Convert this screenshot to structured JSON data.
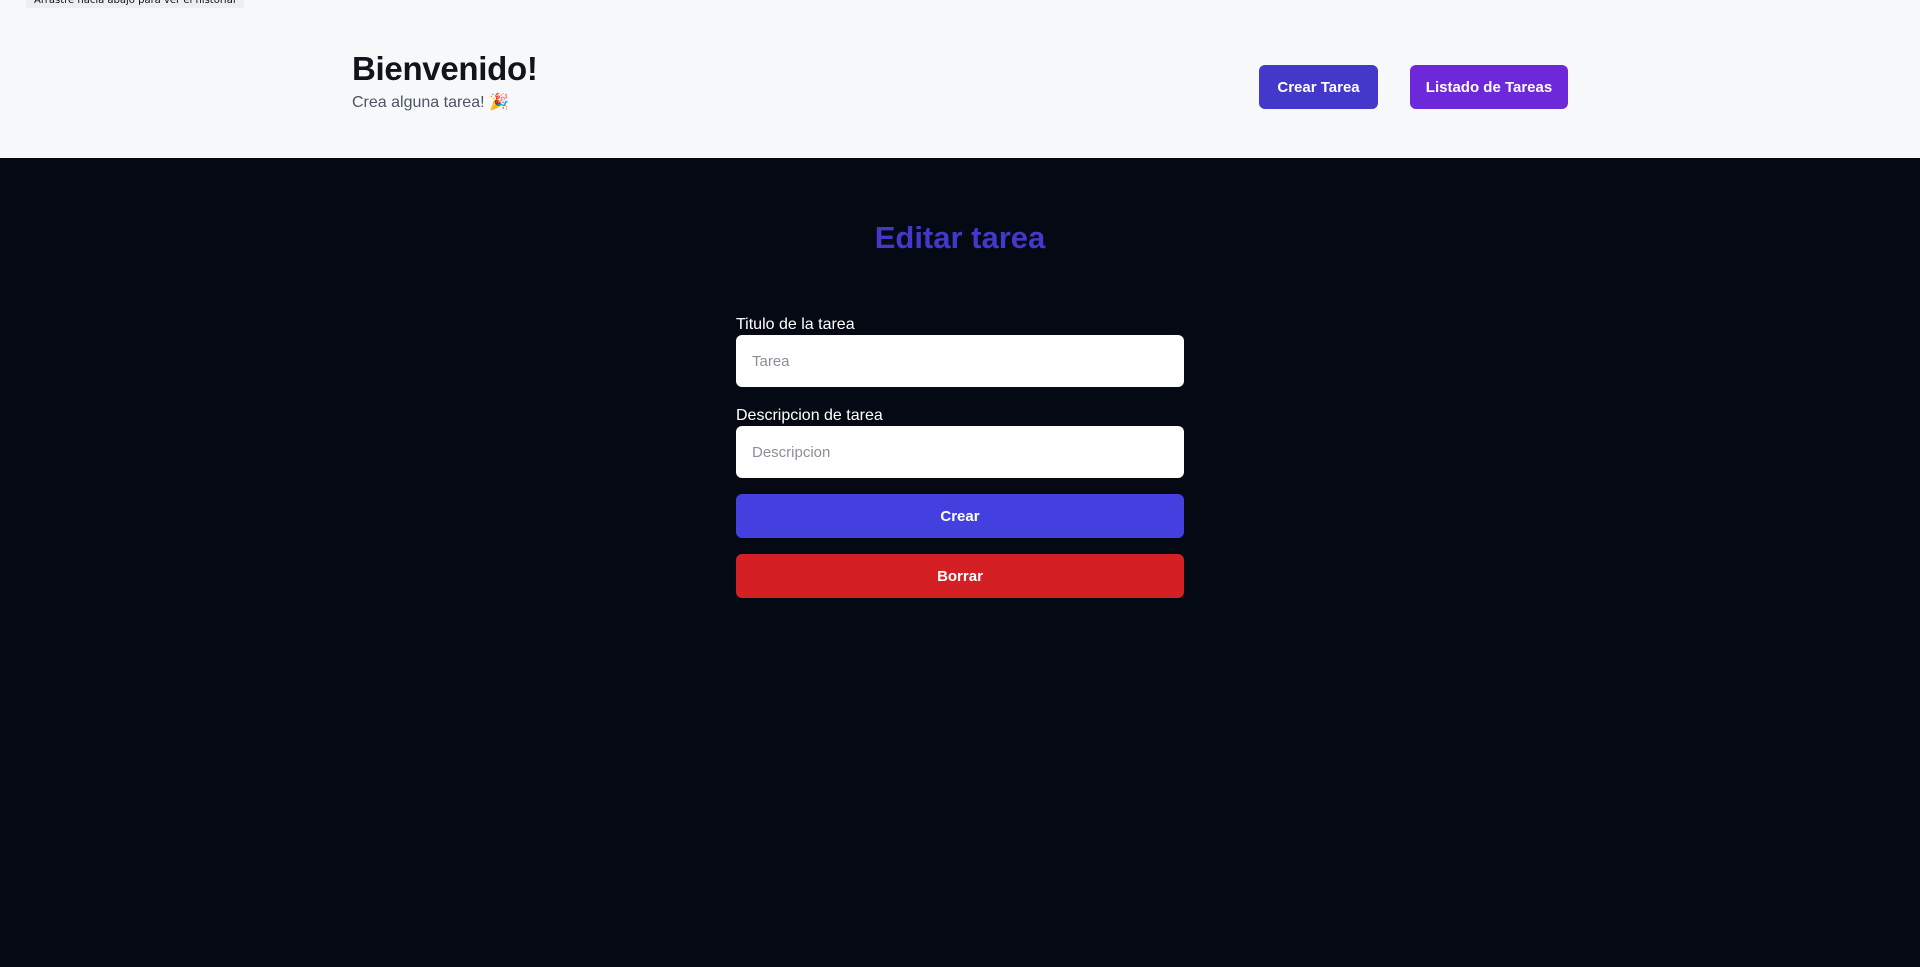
{
  "tooltip": "Arrastre hacia abajo para ver el historial",
  "header": {
    "title": "Bienvenido!",
    "subtitle": "Crea alguna tarea! 🎉",
    "nav": {
      "create_label": "Crear Tarea",
      "list_label": "Listado de Tareas"
    }
  },
  "main": {
    "title": "Editar tarea",
    "form": {
      "title_label": "Titulo de la tarea",
      "title_placeholder": "Tarea",
      "title_value": "",
      "description_label": "Descripcion de tarea",
      "description_placeholder": "Descripcion",
      "description_value": "",
      "submit_label": "Crear",
      "delete_label": "Borrar"
    }
  },
  "colors": {
    "header_bg": "#f7f8fa",
    "page_bg": "#050913",
    "accent_indigo": "#4338ca",
    "accent_purple": "#6d28d9",
    "danger": "#d41f24"
  }
}
